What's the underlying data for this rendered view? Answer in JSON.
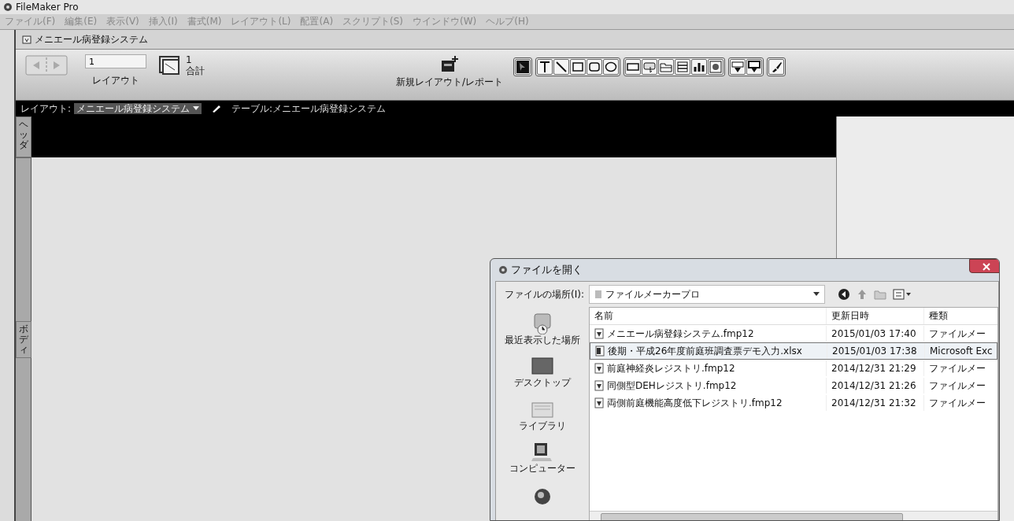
{
  "app": {
    "title": "FileMaker Pro"
  },
  "menu": [
    {
      "label": "ファイル(F)",
      "disabled": true
    },
    {
      "label": "編集(E)",
      "disabled": true
    },
    {
      "label": "表示(V)",
      "disabled": true
    },
    {
      "label": "挿入(I)",
      "disabled": true
    },
    {
      "label": "書式(M)",
      "disabled": true
    },
    {
      "label": "レイアウト(L)",
      "disabled": true
    },
    {
      "label": "配置(A)",
      "disabled": true
    },
    {
      "label": "スクリプト(S)",
      "disabled": true
    },
    {
      "label": "ウインドウ(W)",
      "disabled": true
    },
    {
      "label": "ヘルプ(H)",
      "disabled": true
    }
  ],
  "window": {
    "title": "メニエール病登録システム"
  },
  "toolbar": {
    "record_field": {
      "value": "1"
    },
    "layout_label": "レイアウト",
    "layout_count": "1",
    "total_label": "合計",
    "new_layout_label": "新規レイアウト/レポート"
  },
  "layout_bar": {
    "layout_label": "レイアウト:",
    "layout_value": "メニエール病登録システム",
    "table_label": "テーブル:メニエール病登録システム"
  },
  "parts": [
    {
      "label": "ヘッダ",
      "kind": "header"
    },
    {
      "label": "ボディ",
      "kind": "body"
    }
  ],
  "dialog": {
    "title": "ファイルを開く",
    "location_label": "ファイルの場所(I):",
    "location_value": "ファイルメーカープロ",
    "places": [
      {
        "label": "最近表示した場所",
        "kind": "recent"
      },
      {
        "label": "デスクトップ",
        "kind": "desktop"
      },
      {
        "label": "ライブラリ",
        "kind": "library"
      },
      {
        "label": "コンピューター",
        "kind": "computer"
      },
      {
        "kind": "network"
      }
    ],
    "columns": [
      "名前",
      "更新日時",
      "種類"
    ],
    "files": [
      {
        "name": "メニエール病登録システム.fmp12",
        "modified": "2015/01/03 17:40",
        "type": "ファイルメー",
        "kind": "fmp",
        "selected": false
      },
      {
        "name": "後期・平成26年度前庭班調査票デモ入力.xlsx",
        "modified": "2015/01/03 17:38",
        "type": "Microsoft Exc",
        "kind": "excel",
        "selected": true
      },
      {
        "name": "前庭神経炎レジストリ.fmp12",
        "modified": "2014/12/31 21:29",
        "type": "ファイルメー",
        "kind": "fmp",
        "selected": false
      },
      {
        "name": "同側型DEHレジストリ.fmp12",
        "modified": "2014/12/31 21:26",
        "type": "ファイルメー",
        "kind": "fmp",
        "selected": false
      },
      {
        "name": "両側前庭機能高度低下レジストリ.fmp12",
        "modified": "2014/12/31 21:32",
        "type": "ファイルメー",
        "kind": "fmp",
        "selected": false
      }
    ]
  }
}
